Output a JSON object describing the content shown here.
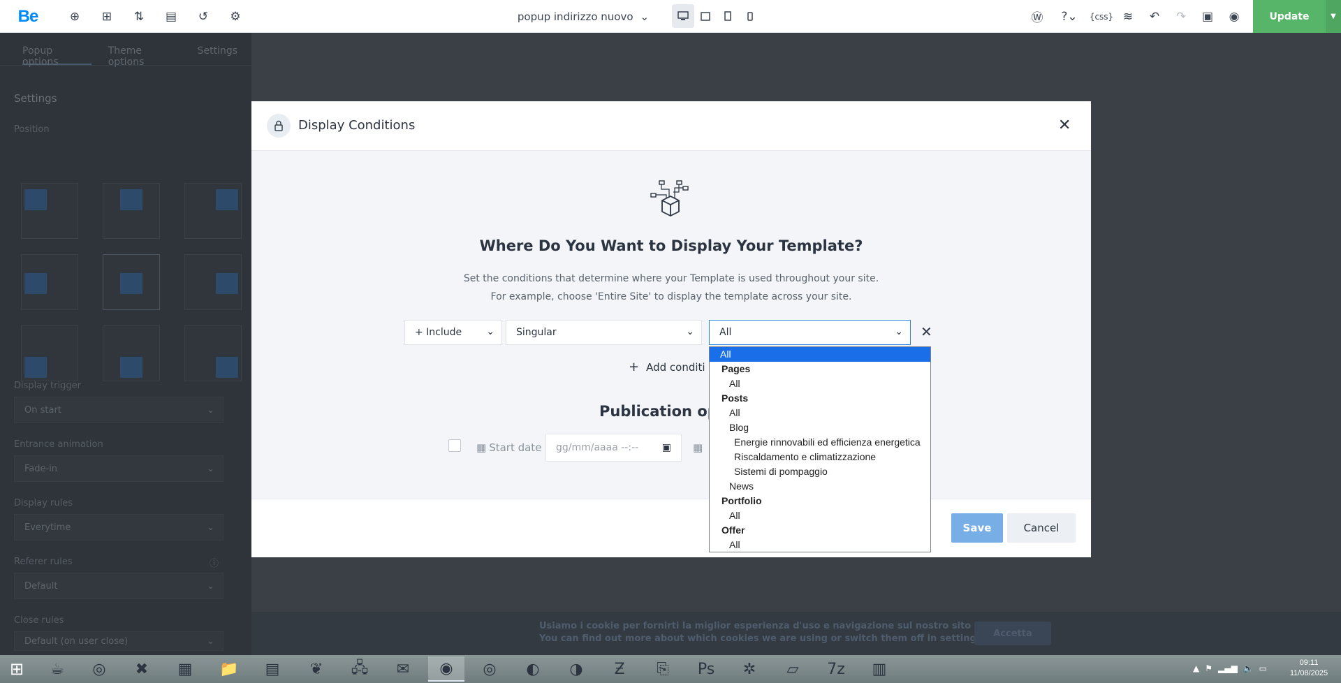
{
  "topbar": {
    "logo": "Be",
    "page_title": "popup indirizzo nuovo",
    "update_label": "Update"
  },
  "sidebar": {
    "tabs": [
      "Popup options",
      "Theme options",
      "Settings"
    ],
    "settings_heading": "Settings",
    "position_label": "Position",
    "display_trigger_label": "Display trigger",
    "display_trigger_value": "On start",
    "entrance_label": "Entrance animation",
    "entrance_value": "Fade-in",
    "display_rules_label": "Display rules",
    "display_rules_value": "Everytime",
    "referer_label": "Referer rules",
    "referer_value": "Default",
    "close_label": "Close rules",
    "close_value": "Default (on user close)"
  },
  "modal": {
    "title": "Display Conditions",
    "question": "Where Do You Want to Display Your Template?",
    "desc_line1": "Set the conditions that determine where your Template is used throughout your site.",
    "desc_line2": "For example, choose 'Entire Site' to display the template across your site.",
    "include_value": "+ Include",
    "type_value": "Singular",
    "target_value": "All",
    "add_condition_label": "Add conditi",
    "publication_label": "Publication opt",
    "start_date_label": "Start date",
    "date_placeholder": "gg/mm/aaaa --:--",
    "save_label": "Save",
    "cancel_label": "Cancel"
  },
  "dropdown": {
    "options": [
      {
        "kind": "option",
        "level": 0,
        "label": "All",
        "selected": true
      },
      {
        "kind": "group",
        "label": "Pages"
      },
      {
        "kind": "option",
        "level": 1,
        "label": "All"
      },
      {
        "kind": "group",
        "label": "Posts"
      },
      {
        "kind": "option",
        "level": 1,
        "label": "All"
      },
      {
        "kind": "option",
        "level": 1,
        "label": "Blog"
      },
      {
        "kind": "option",
        "level": 2,
        "label": "Energie rinnovabili ed efficienza energetica"
      },
      {
        "kind": "option",
        "level": 2,
        "label": "Riscaldamento e climatizzazione"
      },
      {
        "kind": "option",
        "level": 2,
        "label": "Sistemi di pompaggio"
      },
      {
        "kind": "option",
        "level": 1,
        "label": "News"
      },
      {
        "kind": "group",
        "label": "Portfolio"
      },
      {
        "kind": "option",
        "level": 1,
        "label": "All"
      },
      {
        "kind": "group",
        "label": "Offer"
      },
      {
        "kind": "option",
        "level": 1,
        "label": "All"
      }
    ]
  },
  "cookie": {
    "line1": "Usiamo i cookie per fornirti la miglior esperienza d'uso e navigazione sul nostro sito web.",
    "line2": "You can find out more about which cookies we are using or switch them off in settings.",
    "accept_label": "Accetta"
  },
  "taskbar": {
    "time": "09:11",
    "date": "11/08/2025"
  },
  "colors": {
    "accent": "#1a6fe8",
    "update_green": "#57b56a",
    "save_blue": "#78aee6",
    "logo_blue": "#0089f7"
  }
}
